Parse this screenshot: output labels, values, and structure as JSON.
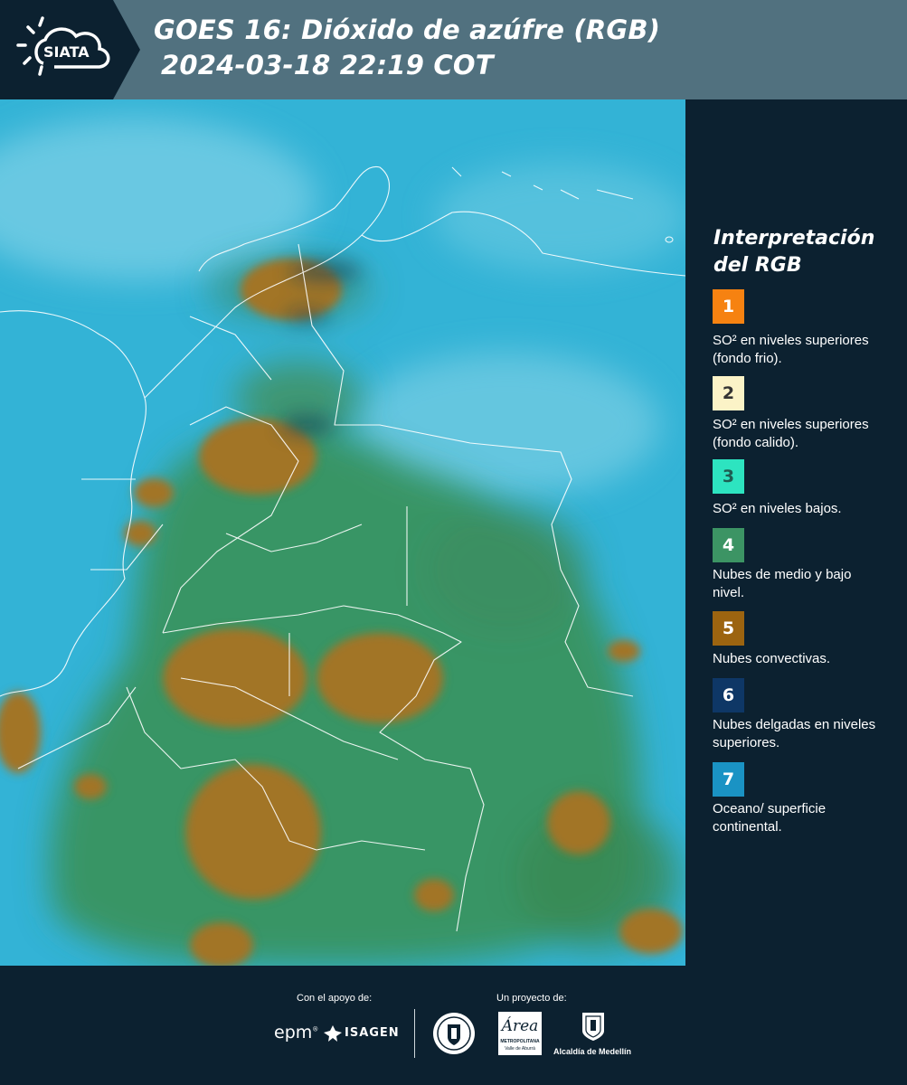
{
  "header": {
    "logo_text": "SIATA",
    "title_line1": "GOES 16: Dióxido de azúfre (RGB)",
    "title_line2": "2024-03-18 22:19 COT"
  },
  "legend": {
    "title_line1": "Interpretación",
    "title_line2": "del RGB",
    "items": [
      {
        "number": "1",
        "color": "#f68211",
        "text": "SO² en niveles superiores (fondo frio)."
      },
      {
        "number": "2",
        "color": "#fbf3c7",
        "text": "SO² en niveles superiores (fondo calido)."
      },
      {
        "number": "3",
        "color": "#2de4c0",
        "text": "SO² en niveles bajos."
      },
      {
        "number": "4",
        "color": "#3c9464",
        "text": "Nubes de medio y bajo nivel."
      },
      {
        "number": "5",
        "color": "#9c6410",
        "text": "Nubes convectivas."
      },
      {
        "number": "6",
        "color": "#0e3766",
        "text": "Nubes delgadas en niveles superiores."
      },
      {
        "number": "7",
        "color": "#1a93c4",
        "text": "Oceano/ superficie continental."
      }
    ]
  },
  "footer": {
    "support_label": "Con el apoyo de:",
    "project_label": "Un proyecto de:",
    "sponsor_epm": "epm",
    "sponsor_isagen": "ISAGEN",
    "area_script": "Área",
    "area_line1": "METROPOLITANA",
    "area_line2": "Valle de Aburrá",
    "alcaldia": "Alcaldía de Medellín"
  }
}
